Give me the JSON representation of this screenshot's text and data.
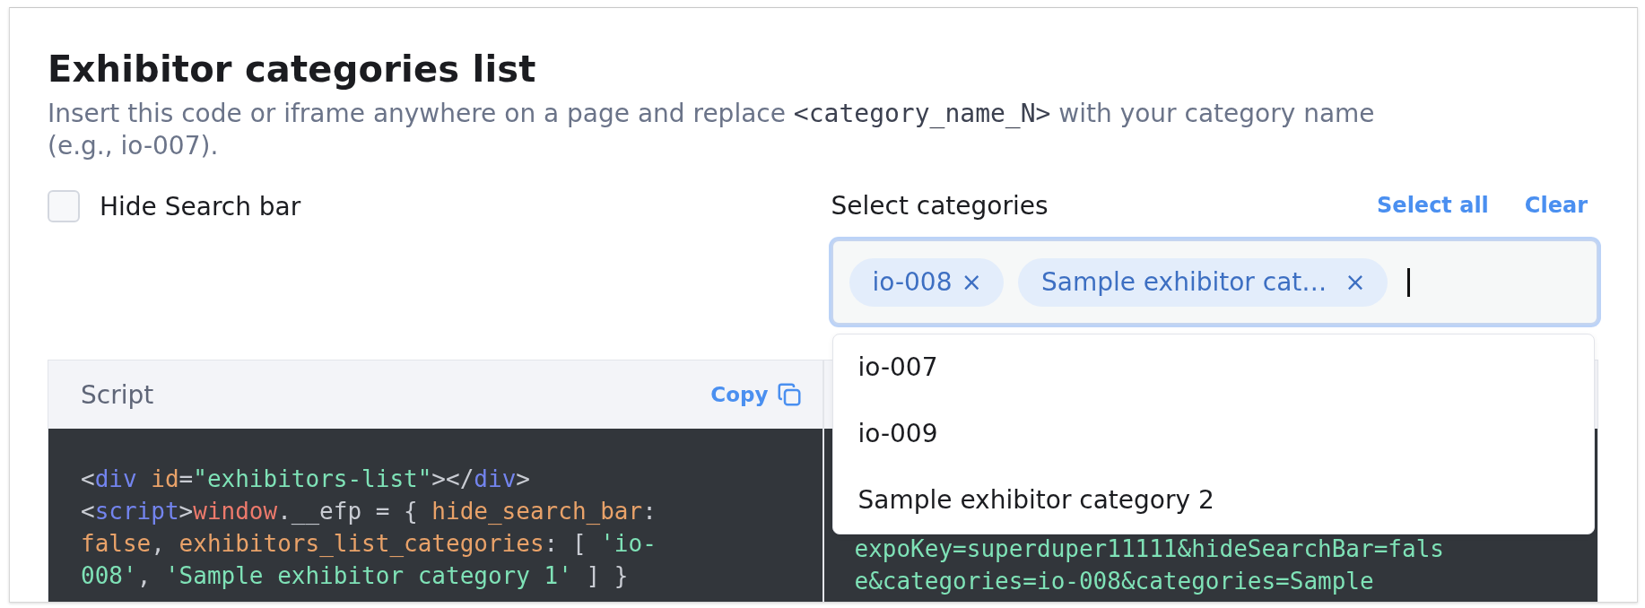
{
  "title": "Exhibitor categories list",
  "description": [
    {
      "kind": "text",
      "text": "Insert this code or iframe anywhere on a page and replace "
    },
    {
      "kind": "code",
      "text": "<category_name_N>"
    },
    {
      "kind": "text",
      "text": " with your category name (e.g., io-007)."
    }
  ],
  "hide_search_bar": {
    "label": "Hide Search bar",
    "checked": false
  },
  "select_categories": {
    "label": "Select categories",
    "select_all": "Select all",
    "clear": "Clear",
    "chips": [
      {
        "label": "io-008",
        "remove": "×"
      },
      {
        "label": "Sample exhibitor cat…",
        "remove": "×"
      }
    ],
    "options": [
      "io-007",
      "io-009",
      "Sample exhibitor category 2"
    ]
  },
  "script_panel": {
    "title": "Script",
    "copy": "Copy",
    "lines": [
      [
        {
          "kind": "punct",
          "text": "<"
        },
        {
          "kind": "tag",
          "text": "div "
        },
        {
          "kind": "attr",
          "text": "id"
        },
        {
          "kind": "punct",
          "text": "="
        },
        {
          "kind": "string",
          "text": "\"exhibitors-list\""
        },
        {
          "kind": "punct",
          "text": "></"
        },
        {
          "kind": "tag",
          "text": "div"
        },
        {
          "kind": "punct",
          "text": ">"
        }
      ],
      [
        {
          "kind": "punct",
          "text": "<"
        },
        {
          "kind": "tag",
          "text": "script"
        },
        {
          "kind": "punct",
          "text": ">"
        },
        {
          "kind": "keyword",
          "text": "window"
        },
        {
          "kind": "punct",
          "text": ".__efp = { "
        },
        {
          "kind": "attr",
          "text": "hide_search_bar"
        },
        {
          "kind": "punct",
          "text": ":"
        }
      ],
      [
        {
          "kind": "attr",
          "text": "false"
        },
        {
          "kind": "punct",
          "text": ", "
        },
        {
          "kind": "attr",
          "text": "exhibitors_list_categories"
        },
        {
          "kind": "punct",
          "text": ": [ "
        },
        {
          "kind": "string",
          "text": "'io-"
        }
      ],
      [
        {
          "kind": "string",
          "text": "008'"
        },
        {
          "kind": "punct",
          "text": ", "
        },
        {
          "kind": "string",
          "text": "'Sample exhibitor category 1'"
        },
        {
          "kind": "punct",
          "text": " ] }"
        }
      ]
    ]
  },
  "iframe_panel": {
    "lines": [
      [
        {
          "kind": "string",
          "text": "expoKey=superduper11111&hideSearchBar=fals"
        }
      ],
      [
        {
          "kind": "string",
          "text": "e&categories=io-008&categories=Sample"
        }
      ]
    ]
  }
}
